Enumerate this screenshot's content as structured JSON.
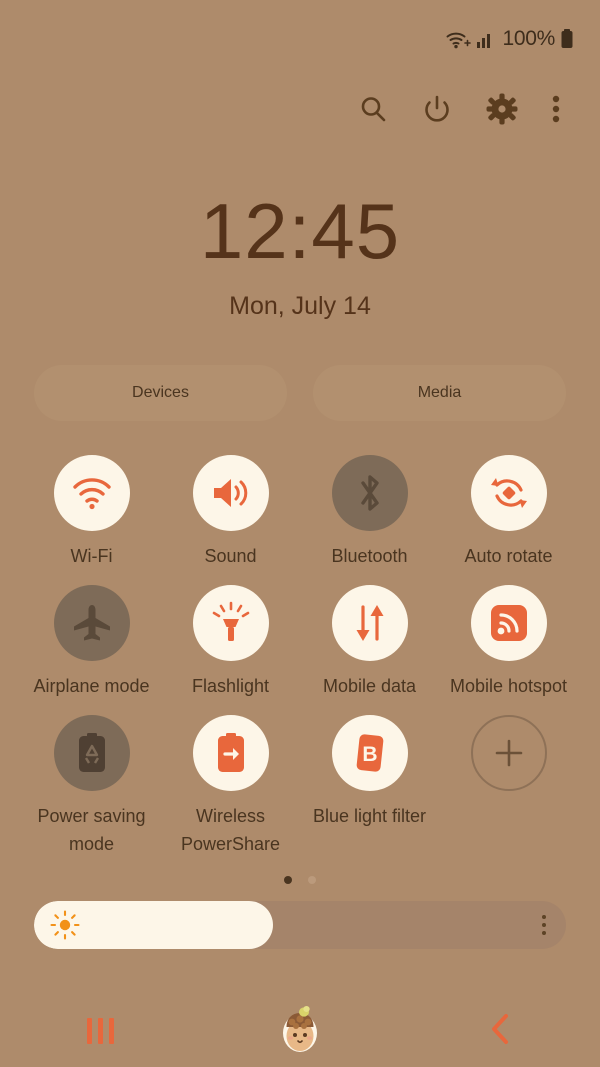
{
  "theme": {
    "background": "#ae8b6b",
    "accent": "#e8673c",
    "tile_on_bg": "#fdf6e8",
    "tile_off_bg": "#7e6b58",
    "text": "#4a3520"
  },
  "statusbar": {
    "wifi_icon": "wifi-icon",
    "signal_icon": "cellular-signal-icon",
    "battery_percent": "100%",
    "battery_icon": "battery-full-icon"
  },
  "actionbar": {
    "items": [
      {
        "name": "search-icon",
        "label": "Search"
      },
      {
        "name": "power-icon",
        "label": "Power off"
      },
      {
        "name": "settings-gear-icon",
        "label": "Settings"
      },
      {
        "name": "more-options-icon",
        "label": "More options"
      }
    ]
  },
  "clock": {
    "time": "12:45",
    "date": "Mon, July 14"
  },
  "pills": [
    {
      "label": "Devices"
    },
    {
      "label": "Media"
    }
  ],
  "tiles": [
    {
      "label": "Wi-Fi",
      "icon": "wifi-icon",
      "state": "on"
    },
    {
      "label": "Sound",
      "icon": "sound-icon",
      "state": "on"
    },
    {
      "label": "Bluetooth",
      "icon": "bluetooth-icon",
      "state": "off"
    },
    {
      "label": "Auto rotate",
      "icon": "auto-rotate-icon",
      "state": "on"
    },
    {
      "label": "Airplane mode",
      "icon": "airplane-icon",
      "state": "off"
    },
    {
      "label": "Flashlight",
      "icon": "flashlight-icon",
      "state": "on"
    },
    {
      "label": "Mobile data",
      "icon": "mobile-data-icon",
      "state": "on"
    },
    {
      "label": "Mobile hotspot",
      "icon": "hotspot-icon",
      "state": "on"
    },
    {
      "label": "Power saving mode",
      "icon": "power-saving-icon",
      "state": "off"
    },
    {
      "label": "Wireless PowerShare",
      "icon": "powershare-icon",
      "state": "on"
    },
    {
      "label": "Blue light filter",
      "icon": "blue-light-icon",
      "state": "on"
    },
    {
      "label": "",
      "icon": "add-tile-icon",
      "state": "add"
    }
  ],
  "pager": {
    "total_pages": 2,
    "current_page": 1
  },
  "brightness": {
    "level_percent": 45,
    "sun_icon": "brightness-sun-icon",
    "menu_icon": "brightness-options-icon"
  },
  "navbar": {
    "recents_label": "Recents",
    "home_label": "Home",
    "back_label": "Back",
    "home_icon": "acorn-home-icon"
  }
}
